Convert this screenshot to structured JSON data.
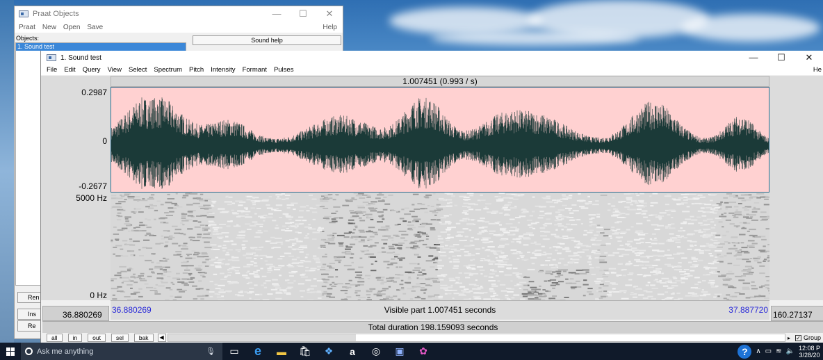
{
  "objects_window": {
    "title": "Praat Objects",
    "menu": [
      "Praat",
      "New",
      "Open",
      "Save"
    ],
    "help": "Help",
    "objects_label": "Objects:",
    "selected_object": "1. Sound test",
    "sound_help_button": "Sound help",
    "cut_buttons": [
      "Ren",
      "Ins",
      "Re"
    ]
  },
  "sound_window": {
    "title": "1. Sound test",
    "menu": [
      "File",
      "Edit",
      "Query",
      "View",
      "Select",
      "Spectrum",
      "Pitch",
      "Intensity",
      "Formant",
      "Pulses"
    ],
    "help": "He",
    "window_controls": [
      "—",
      "☐",
      "✕"
    ],
    "selection_readout": "1.007451 (0.993 / s)",
    "waveform": {
      "y_max": "0.2987",
      "y_zero": "0",
      "y_min": "-0.2677",
      "colors": {
        "background": "#ffd1d1",
        "signal": "#1b3a38"
      }
    },
    "spectrogram": {
      "y_top": "5000 Hz",
      "y_bottom": "0 Hz"
    },
    "window_start": "36.880269",
    "window_end": "37.887720",
    "visible_part": "Visible part 1.007451 seconds",
    "outer_left": "36.880269",
    "outer_right": "160.27137",
    "total_duration": "Total duration 198.159093 seconds",
    "zoom_buttons": [
      "all",
      "in",
      "out",
      "sel",
      "bak"
    ],
    "group_label": "Group",
    "group_checked": true
  },
  "taskbar": {
    "search_placeholder": "Ask me anything",
    "clock_time": "12:08 P",
    "clock_date": "3/28/20"
  }
}
